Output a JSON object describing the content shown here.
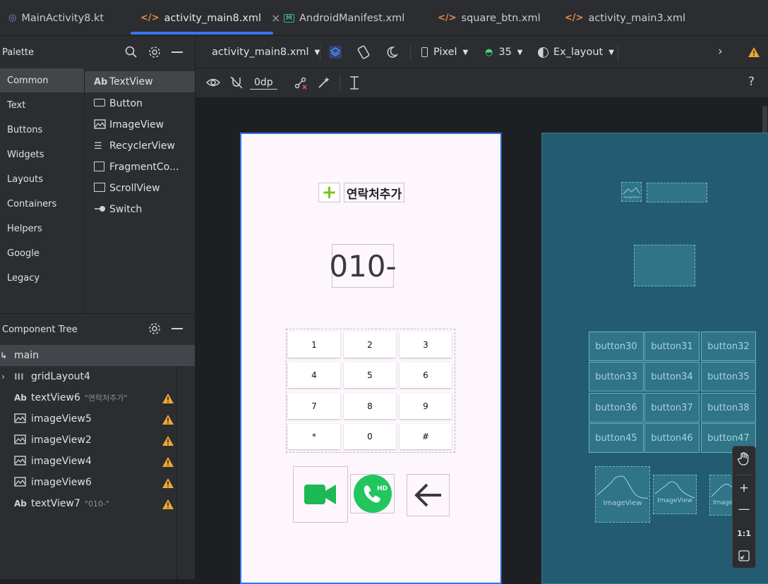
{
  "tabs": [
    {
      "label": "MainActivity8.kt",
      "icon": "kotlin-file-icon"
    },
    {
      "label": "activity_main8.xml",
      "icon": "xml-file-icon",
      "close": "×"
    },
    {
      "label": "AndroidManifest.xml",
      "icon": "manifest-file-icon"
    },
    {
      "label": "square_btn.xml",
      "icon": "xml-file-icon"
    },
    {
      "label": "activity_main3.xml",
      "icon": "xml-file-icon"
    }
  ],
  "palette": {
    "title": "Palette",
    "categories": [
      "Common",
      "Text",
      "Buttons",
      "Widgets",
      "Layouts",
      "Containers",
      "Helpers",
      "Google",
      "Legacy"
    ],
    "items": [
      {
        "icon": "Ab",
        "label": "TextView"
      },
      {
        "icon": "button-icon",
        "label": "Button"
      },
      {
        "icon": "image-icon",
        "label": "ImageView"
      },
      {
        "icon": "list-icon",
        "label": "RecyclerView"
      },
      {
        "icon": "fragment-icon",
        "label": "FragmentCo..."
      },
      {
        "icon": "scroll-icon",
        "label": "ScrollView"
      },
      {
        "icon": "switch-icon",
        "label": "Switch"
      }
    ]
  },
  "tree": {
    "title": "Component Tree",
    "rows": [
      {
        "icon": "layout-icon",
        "label": "main",
        "sub": "",
        "warn": false
      },
      {
        "icon": "grid-icon",
        "label": "gridLayout4",
        "sub": "",
        "warn": false
      },
      {
        "icon": "Ab",
        "label": "textView6",
        "sub": "\"연락처추가\"",
        "warn": true
      },
      {
        "icon": "image-icon",
        "label": "imageView5",
        "sub": "",
        "warn": true
      },
      {
        "icon": "image-icon",
        "label": "imageView2",
        "sub": "",
        "warn": true
      },
      {
        "icon": "image-icon",
        "label": "imageView4",
        "sub": "",
        "warn": true
      },
      {
        "icon": "image-icon",
        "label": "imageView6",
        "sub": "",
        "warn": true
      },
      {
        "icon": "Ab",
        "label": "textView7",
        "sub": "\"010-\"",
        "warn": true
      }
    ]
  },
  "toolbar": {
    "file": "activity_main8.xml",
    "device": "Pixel",
    "api": "35",
    "theme": "Ex_layout",
    "margin": "0dp",
    "help": "?"
  },
  "phone": {
    "add_contact": "연락처추가",
    "plus": "+",
    "number": "010-",
    "keys": [
      "1",
      "2",
      "3",
      "4",
      "5",
      "6",
      "7",
      "8",
      "9",
      "*",
      "0",
      "#"
    ],
    "hd": "HD"
  },
  "blueprint": {
    "buttons": [
      "button30",
      "button31",
      "button32",
      "button33",
      "button34",
      "button35",
      "button36",
      "button37",
      "button38",
      "button45",
      "button46",
      "button47"
    ],
    "image_label": "ImageView",
    "image_label_small": "ImageView",
    "image_label_cut": "Image",
    "tiny_label": "ImageView"
  },
  "zoom": {
    "plus": "+",
    "minus": "—",
    "ratio": "1:1"
  },
  "colors": {
    "accent": "#3574f0",
    "warning": "#f0a732",
    "phone_bg": "#fdf7fd",
    "blueprint_bg": "#235c70",
    "video_green": "#1db954",
    "call_green": "#22c55e"
  }
}
